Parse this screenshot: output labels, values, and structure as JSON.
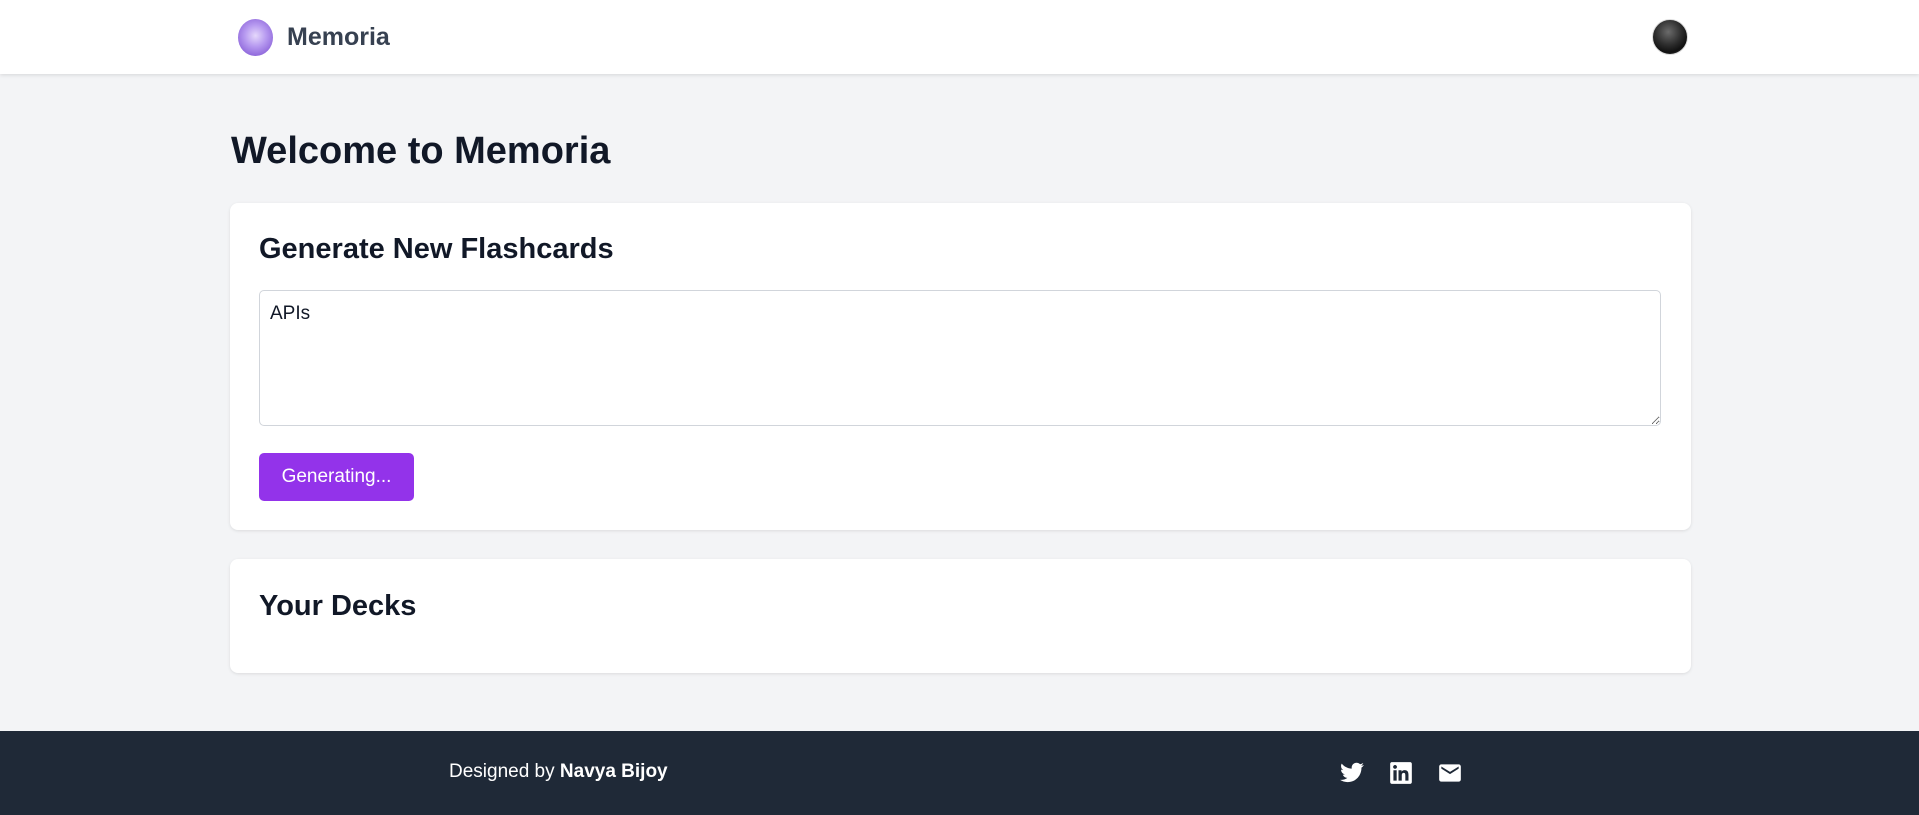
{
  "header": {
    "brand_name": "Memoria",
    "logo_icon": "gradient-orb-logo",
    "avatar_icon": "user-avatar"
  },
  "main": {
    "page_title": "Welcome to Memoria",
    "generate_card": {
      "title": "Generate New Flashcards",
      "input_value": "APIs",
      "button_label": "Generating..."
    },
    "decks_card": {
      "title": "Your Decks"
    }
  },
  "footer": {
    "credit_prefix": "Designed by",
    "credit_name": "Navya Bijoy",
    "social_icons": [
      "twitter-icon",
      "linkedin-icon",
      "mail-icon"
    ]
  },
  "colors": {
    "accent": "#9333ea",
    "footer_bg": "#1f2937",
    "page_bg": "#f3f4f6",
    "heading": "#111827"
  }
}
